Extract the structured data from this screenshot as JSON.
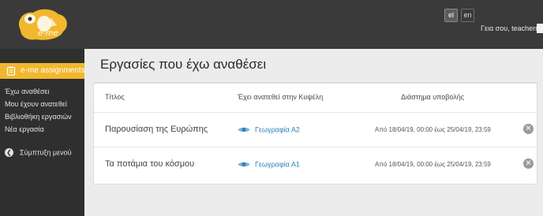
{
  "header": {
    "logo_text": "e-me",
    "languages": [
      {
        "code": "el",
        "active": true
      },
      {
        "code": "en",
        "active": false
      }
    ],
    "greeting": "Γεια σου, teachernp"
  },
  "sidebar": {
    "app_title": "e-me assignments",
    "items": [
      {
        "label": "Έχω αναθέσει"
      },
      {
        "label": "Μου έχουν ανατεθεί"
      },
      {
        "label": "Βιβλιοθήκη εργασιών"
      },
      {
        "label": "Νέα εργασία"
      }
    ],
    "collapse_label": "Σύμπτυξη μενού"
  },
  "main": {
    "title": "Εργασίες που έχω αναθέσει",
    "columns": [
      "Τίτλος",
      "Έχει ανατεθεί στην Κυψέλη",
      "Διάστημα υποβολής"
    ],
    "rows": [
      {
        "title": "Παρουσίαση της Ευρώπης",
        "course": "Γεωγραφία Α2",
        "period": "Από 18/04/19, 00:00 έως 25/04/19, 23:59"
      },
      {
        "title": "Τα ποτάμια του κόσμου",
        "course": "Γεωγραφία Α1",
        "period": "Από 18/04/19, 00:00 έως 25/04/19, 23:59"
      }
    ]
  },
  "colors": {
    "topbar": "#3a3a3a",
    "sidebar": "#2f2f2f",
    "accent": "#f2b72e",
    "link": "#2c7fb8"
  },
  "icons": [
    "e-me-logo",
    "assignment-icon",
    "chevron-left-icon",
    "eye-icon",
    "close-icon"
  ]
}
